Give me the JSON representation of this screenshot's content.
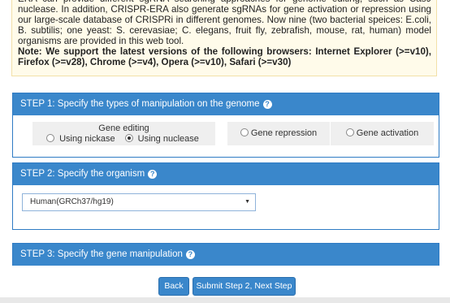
{
  "intro": {
    "paragraph": "ERA can provide different sgRNA searching approaches for genome editing, such as Cas9 nuclease. In addition, CRISPR-ERA also generate sgRNAs for gene activation or repression using our large-scale database of CRISPRi in different genomes. Now nine (two bacterial speices: E.coli, B. subtilis; one yeast: S. cerevasiae; C. elegans, fruit fly, zebrafish, mouse, rat, human) model organisms are provided in this web tool.",
    "note": "Note: We support the latest versions of the following browsers: Internet Explorer (>=v10), Firefox (>=v28), Chrome (>=v4), Opera (>=v10), Safari (>=v30)"
  },
  "step1": {
    "title": "STEP 1: Specify the types of manipulation on the genome",
    "help": "?",
    "gene_editing_label": "Gene editing",
    "nickase_label": "Using nickase",
    "nuclease_label": "Using nuclease",
    "repression_label": "Gene repression",
    "activation_label": "Gene activation",
    "selected": "Using nuclease"
  },
  "step2": {
    "title": "STEP 2: Specify the organism",
    "help": "?",
    "organism_selected": "Human(GRCh37/hg19)",
    "caret": "▼"
  },
  "step3": {
    "title": "STEP 3: Specify the gene manipulation",
    "help": "?"
  },
  "buttons": {
    "back": "Back",
    "next": "Submit Step 2, Next Step"
  },
  "colors": {
    "panel_header": "#3a87cb",
    "intro_bg": "#fffbea",
    "button": "#3a87cb"
  }
}
